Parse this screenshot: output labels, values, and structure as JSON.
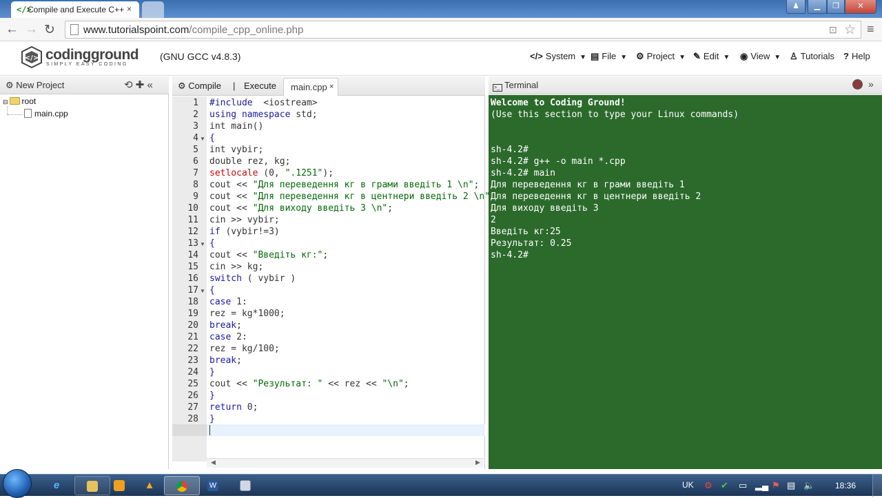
{
  "browser": {
    "tab_title": "Compile and Execute C++",
    "tab_close": "×",
    "url_host": "www.tutorialspoint.com",
    "url_path": "/compile_cpp_online.php"
  },
  "header": {
    "logo_word": "codingground",
    "logo_tagline": "SIMPLY EASY CODING",
    "compiler": "(GNU GCC v4.8.3)",
    "menus": [
      {
        "icon": "</>",
        "label": "System"
      },
      {
        "icon": "▤",
        "label": "File"
      },
      {
        "icon": "⚙",
        "label": "Project"
      },
      {
        "icon": "✎",
        "label": "Edit"
      },
      {
        "icon": "◉",
        "label": "View"
      },
      {
        "icon": "♙",
        "label": "Tutorials"
      },
      {
        "icon": "?",
        "label": "Help"
      }
    ]
  },
  "left_panel": {
    "new_project": "New Project",
    "tree_root": "root",
    "tree_file": "main.cpp"
  },
  "editor": {
    "compile_label": "Compile",
    "separator": "|",
    "execute_label": "Execute",
    "tab_label": "main.cpp",
    "tab_close": "×",
    "line_numbers": [
      "1",
      "2",
      "3",
      "4",
      "5",
      "6",
      "7",
      "8",
      "9",
      "10",
      "11",
      "12",
      "13",
      "14",
      "15",
      "16",
      "17",
      "18",
      "19",
      "20",
      "21",
      "22",
      "23",
      "24",
      "25",
      "26",
      "27",
      "28",
      "29"
    ],
    "fold_lines": [
      4,
      13,
      17
    ],
    "code_lines": [
      [
        [
          "kw",
          "#include"
        ],
        [
          "",
          "  <iostream>"
        ]
      ],
      [
        [
          "kw",
          "using namespace"
        ],
        [
          "",
          " std;"
        ]
      ],
      [
        [
          "",
          "int main()"
        ]
      ],
      [
        [
          "kw",
          "{"
        ]
      ],
      [
        [
          "",
          "int vybir;"
        ]
      ],
      [
        [
          "",
          "double rez, kg;"
        ]
      ],
      [
        [
          "fn",
          "setlocale"
        ],
        [
          "",
          " (0, "
        ],
        [
          "str",
          "\".1251\""
        ],
        [
          "",
          ");"
        ]
      ],
      [
        [
          "",
          "cout << "
        ],
        [
          "str",
          "\"Для переведення кг в грами введіть 1 \\n\""
        ],
        [
          "",
          ";"
        ]
      ],
      [
        [
          "",
          "cout << "
        ],
        [
          "str",
          "\"Для переведення кг в центнери введіть 2 \\n\""
        ]
      ],
      [
        [
          "",
          "cout << "
        ],
        [
          "str",
          "\"Для виходу введіть 3 \\n\""
        ],
        [
          "",
          ";"
        ]
      ],
      [
        [
          "",
          "cin >> vybir;"
        ]
      ],
      [
        [
          "kw",
          "if"
        ],
        [
          "",
          " (vybir!=3)"
        ]
      ],
      [
        [
          "kw",
          "{"
        ]
      ],
      [
        [
          "",
          "cout << "
        ],
        [
          "str",
          "\"Введіть кг:\""
        ],
        [
          "",
          ";"
        ]
      ],
      [
        [
          "",
          "cin >> kg;"
        ]
      ],
      [
        [
          "kw",
          "switch"
        ],
        [
          "",
          " ( vybir )"
        ]
      ],
      [
        [
          "kw",
          "{"
        ]
      ],
      [
        [
          "kw",
          "case"
        ],
        [
          "",
          " 1:"
        ]
      ],
      [
        [
          "",
          "rez = kg*1000;"
        ]
      ],
      [
        [
          "kw",
          "break"
        ],
        [
          "",
          ";"
        ]
      ],
      [
        [
          "kw",
          "case"
        ],
        [
          "",
          " 2:"
        ]
      ],
      [
        [
          "",
          "rez = kg/100;"
        ]
      ],
      [
        [
          "kw",
          "break"
        ],
        [
          "",
          ";"
        ]
      ],
      [
        [
          "kw",
          "}"
        ]
      ],
      [
        [
          "",
          "cout << "
        ],
        [
          "str",
          "\"Результат: \""
        ],
        [
          "",
          " << rez << "
        ],
        [
          "str",
          "\"\\n\""
        ],
        [
          "",
          ";"
        ]
      ],
      [
        [
          "kw",
          "}"
        ]
      ],
      [
        [
          "kw",
          "return"
        ],
        [
          "",
          " 0;"
        ]
      ],
      [
        [
          "kw",
          "}"
        ]
      ],
      [
        [
          "",
          ""
        ]
      ]
    ]
  },
  "terminal": {
    "title": "Terminal",
    "lines": [
      {
        "text": "Welcome to Coding Ground!",
        "bold": true
      },
      {
        "text": "(Use this section to type your Linux commands)",
        "bold": false
      },
      {
        "text": "",
        "bold": false
      },
      {
        "text": "",
        "bold": false
      },
      {
        "text": "sh-4.2#",
        "bold": false
      },
      {
        "text": "sh-4.2# g++ -o main *.cpp",
        "bold": false
      },
      {
        "text": "sh-4.2# main",
        "bold": false
      },
      {
        "text": "Для переведення кг в грами введіть 1",
        "bold": false
      },
      {
        "text": "Для переведення кг в центнери введіть 2",
        "bold": false
      },
      {
        "text": "Для виходу введіть 3",
        "bold": false
      },
      {
        "text": "2",
        "bold": false
      },
      {
        "text": "Введіть кг:25",
        "bold": false
      },
      {
        "text": "Результат: 0.25",
        "bold": false
      },
      {
        "text": "sh-4.2#",
        "bold": false
      }
    ]
  },
  "taskbar": {
    "language": "UK",
    "clock": "18:36"
  },
  "colors": {
    "terminal_bg": "#2b6a2b",
    "keyword": "#1a1aa6",
    "string": "#036a07",
    "function": "#c5060b"
  }
}
